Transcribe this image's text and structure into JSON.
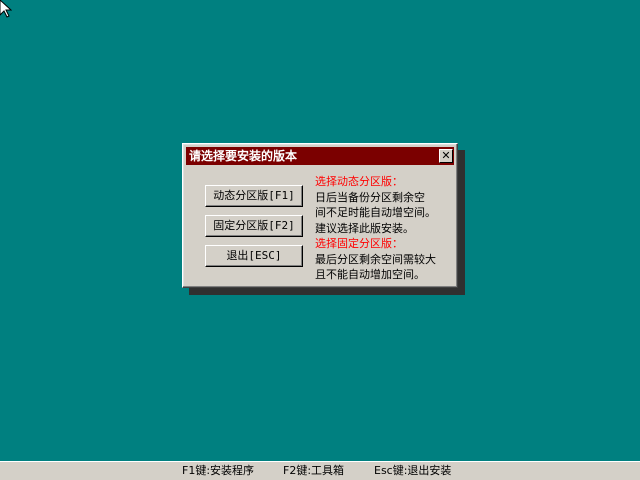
{
  "dialog": {
    "title": "请选择要安装的版本",
    "close_glyph": "✕",
    "buttons": {
      "dynamic": "动态分区版[F1]",
      "fixed": "固定分区版[F2]",
      "exit": "退出[ESC]"
    },
    "description": {
      "dynamic_heading": "选择动态分区版：",
      "dynamic_lines": [
        "日后当备份分区剩余空",
        "间不足时能自动增空间。",
        "建议选择此版安装。"
      ],
      "fixed_heading": "选择固定分区版：",
      "fixed_lines": [
        "最后分区剩余空间需较大",
        "且不能自动增加空间。"
      ]
    }
  },
  "statusbar": {
    "f1": "F1键:安装程序",
    "f2": "F2键:工具箱",
    "esc": "Esc键:退出安装"
  },
  "colors": {
    "desktop": "#008080",
    "titlebar": "#7b0000",
    "window": "#d4d0c8",
    "heading_red": "#ff0000"
  },
  "icons": {
    "cursor": "mouse-pointer-icon",
    "close": "close-icon"
  }
}
